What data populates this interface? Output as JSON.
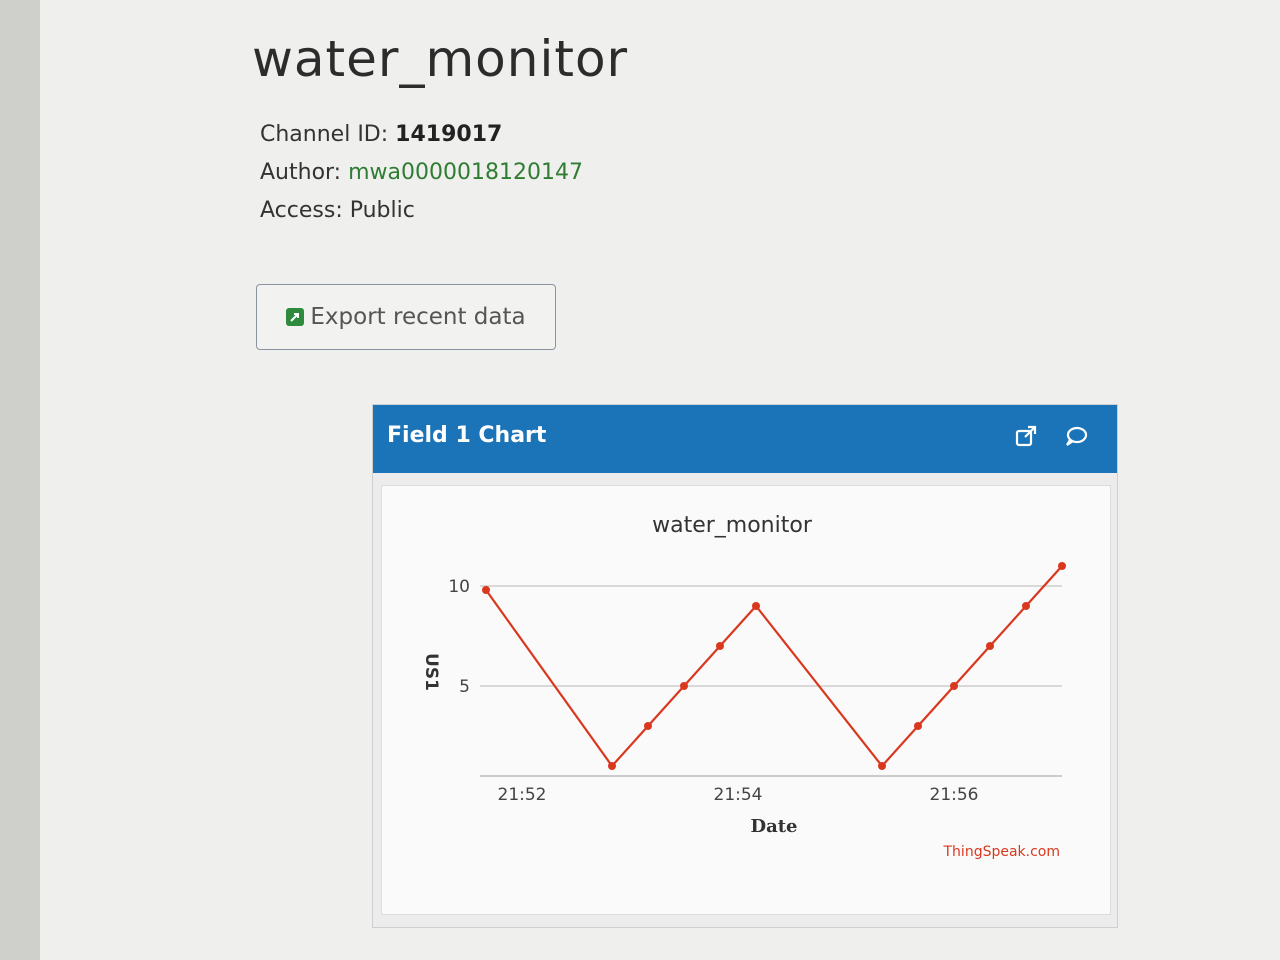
{
  "channel": {
    "title": "water_monitor",
    "channel_id_label": "Channel ID:",
    "channel_id": "1419017",
    "author_label": "Author:",
    "author": "mwa0000018120147",
    "access_label": "Access:",
    "access": "Public"
  },
  "export_button": {
    "label": "Export recent data",
    "icon": "external-link-icon"
  },
  "panel": {
    "title": "Field 1 Chart",
    "icons": [
      "popout-icon",
      "comment-icon"
    ],
    "header_color": "#1b74b8"
  },
  "chart_data": {
    "type": "line",
    "title": "water_monitor",
    "xlabel": "Date",
    "ylabel": "US1",
    "x_ticks": [
      "21:52",
      "21:54",
      "21:56"
    ],
    "y_ticks": [
      5,
      10
    ],
    "ylim": [
      0.5,
      10.5
    ],
    "grid": true,
    "series": [
      {
        "color": "#d9381e",
        "points": [
          {
            "x": "21:51:40",
            "y": 9.8
          },
          {
            "x": "21:52:50",
            "y": 1
          },
          {
            "x": "21:53:10",
            "y": 3
          },
          {
            "x": "21:53:30",
            "y": 5
          },
          {
            "x": "21:53:50",
            "y": 7
          },
          {
            "x": "21:54:10",
            "y": 9
          },
          {
            "x": "21:55:20",
            "y": 1
          },
          {
            "x": "21:55:40",
            "y": 3
          },
          {
            "x": "21:56:00",
            "y": 5
          },
          {
            "x": "21:56:20",
            "y": 7
          },
          {
            "x": "21:56:40",
            "y": 9
          },
          {
            "x": "21:57:00",
            "y": 11
          }
        ]
      }
    ],
    "credit": "ThingSpeak.com"
  }
}
